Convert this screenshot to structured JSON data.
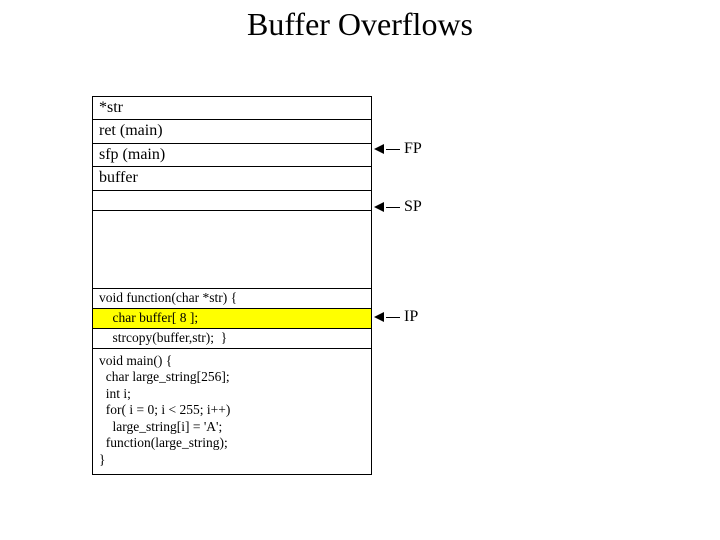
{
  "title": "Buffer Overflows",
  "stack": {
    "arg": "*str",
    "ret": "ret (main)",
    "sfp": "sfp (main)",
    "buffer": "buffer"
  },
  "code": {
    "fn_decl": "void function(char *str) {",
    "buf_decl": "    char buffer[ 8 ];",
    "strcpy": "    strcopy(buffer,str);  }",
    "main_block": "void main() {\n  char large_string[256];\n  int i;\n  for( i = 0; i < 255; i++)\n    large_string[i] = 'A';\n  function(large_string);\n}"
  },
  "pointers": {
    "fp": "FP",
    "sp": "SP",
    "ip": "IP"
  }
}
